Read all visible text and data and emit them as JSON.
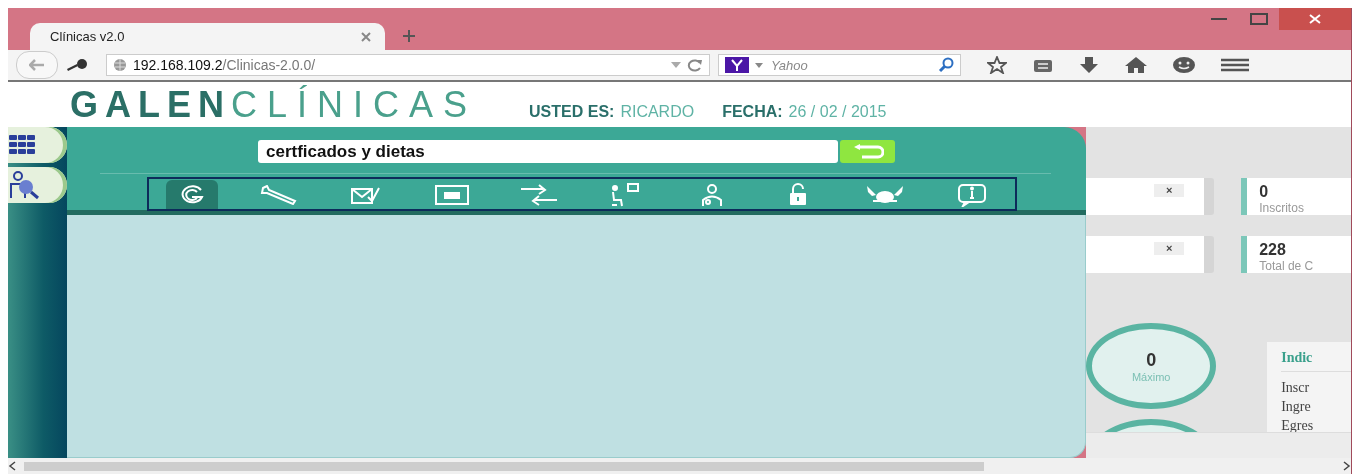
{
  "browser": {
    "tab": {
      "title": "Clínicas v2.0"
    },
    "url": {
      "host": "192.168.109.2",
      "path": "/Clinicas-2.0.0/"
    },
    "search": {
      "placeholder": "Yahoo"
    }
  },
  "header": {
    "logo": {
      "bold": "GALEN",
      "light": "CLÍNICAS"
    },
    "user_label": "USTED ES:",
    "user": "RICARDO",
    "date_label": "FECHA:",
    "date": "26 / 02 / 2015"
  },
  "menu_panel": {
    "search": {
      "value": "certficados y dietas"
    },
    "tabs": [
      {
        "kind": "galen",
        "selected": true
      },
      {
        "kind": "wrench",
        "selected": false
      },
      {
        "kind": "mail",
        "selected": false
      },
      {
        "kind": "window",
        "selected": false
      },
      {
        "kind": "arrows",
        "selected": false
      },
      {
        "kind": "chair",
        "selected": false
      },
      {
        "kind": "doctor",
        "selected": false
      },
      {
        "kind": "lock",
        "selected": false
      },
      {
        "kind": "crab",
        "selected": false
      },
      {
        "kind": "info",
        "selected": false
      }
    ]
  },
  "cards": [
    {
      "close": "×"
    },
    {
      "close": "×"
    }
  ],
  "stats": [
    {
      "value": "0",
      "label": "Inscritos"
    },
    {
      "value": "228",
      "label": "Total de C"
    }
  ],
  "gauge": {
    "value": "0",
    "label": "Máximo"
  },
  "indicators": {
    "title": "Indic",
    "items": [
      "Inscr",
      "Ingre",
      "Egres"
    ]
  }
}
